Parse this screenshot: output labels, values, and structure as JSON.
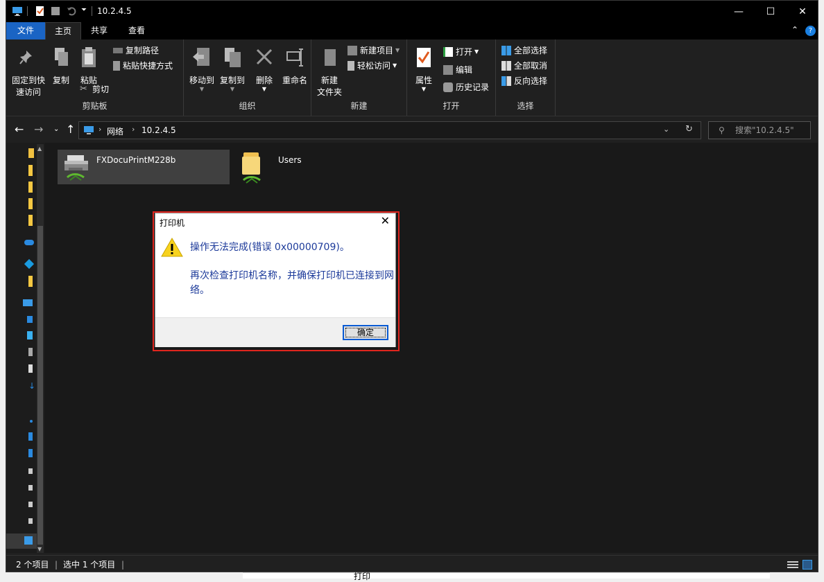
{
  "window": {
    "title": "10.2.4.5",
    "controls": {
      "minimize": "—",
      "maximize": "☐",
      "close": "✕"
    }
  },
  "tabs": [
    {
      "label": "文件"
    },
    {
      "label": "主页"
    },
    {
      "label": "共享"
    },
    {
      "label": "查看"
    }
  ],
  "ribbon": {
    "clipboard": {
      "pin_label_line1": "固定到快",
      "pin_label_line2": "速访问",
      "copy": "复制",
      "paste": "粘贴",
      "copy_path": "复制路径",
      "paste_shortcut": "粘贴快捷方式",
      "cut": "剪切",
      "group": "剪贴板"
    },
    "organize": {
      "move_to": "移动到",
      "copy_to": "复制到",
      "delete": "删除",
      "rename": "重命名",
      "group": "组织"
    },
    "new": {
      "new_folder_line1": "新建",
      "new_folder_line2": "文件夹",
      "new_item": "新建项目",
      "easy_access": "轻松访问",
      "group": "新建"
    },
    "open": {
      "properties": "属性",
      "open": "打开",
      "edit": "编辑",
      "history": "历史记录",
      "group": "打开"
    },
    "select": {
      "select_all": "全部选择",
      "select_none": "全部取消",
      "invert": "反向选择",
      "group": "选择"
    }
  },
  "address": {
    "crumb1": "网络",
    "crumb2": "10.2.4.5",
    "search_placeholder": "搜索\"10.2.4.5\""
  },
  "items": [
    {
      "label": "FXDocuPrintM228b",
      "type": "printer",
      "selected": true
    },
    {
      "label": "Users",
      "type": "shared-folder",
      "selected": false
    }
  ],
  "status": {
    "count": "2 个项目",
    "selected": "选中 1 个项目"
  },
  "dialog": {
    "title": "打印机",
    "message": "操作无法完成(错误 0x00000709)。",
    "detail": "再次检查打印机名称，并确保打印机已连接到网络。",
    "ok": "确定"
  },
  "background_window": {
    "title": "打印"
  },
  "colors": {
    "file_tab": "#1a64c4",
    "dialog_highlight": "#e0251e",
    "dialog_text": "#1c3a9a"
  }
}
